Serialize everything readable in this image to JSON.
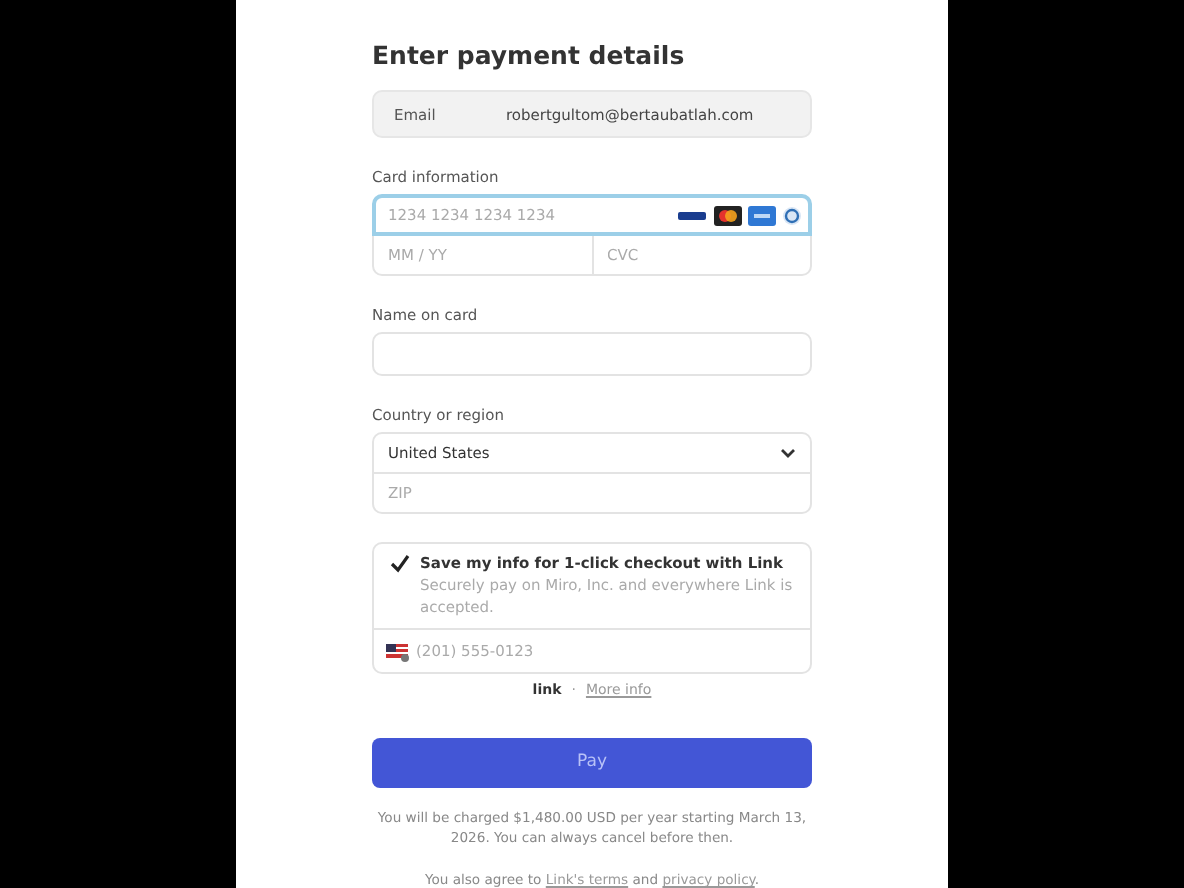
{
  "title": "Enter payment details",
  "email": {
    "label": "Email",
    "value": "robertgultom@bertaubatlah.com"
  },
  "card": {
    "label": "Card information",
    "number_placeholder": "1234 1234 1234 1234",
    "focused": true,
    "expiry_placeholder": "MM / YY",
    "cvc_placeholder": "CVC"
  },
  "name": {
    "label": "Name on card"
  },
  "country": {
    "label": "Country or region",
    "value": "United States",
    "zip_placeholder": "ZIP"
  },
  "link": {
    "checked": true,
    "title": "Save my info for 1-click checkout with Link",
    "description": "Securely pay on Miro, Inc. and everywhere Link is accepted.",
    "phone_placeholder": "(201) 555-0123",
    "logo": "link",
    "separator": "·",
    "more_info": "More info"
  },
  "pay_button": "Pay",
  "charge_note": "You will be charged $1,480.00 USD per year starting March 13, 2026. You can always cancel before then.",
  "terms": {
    "before": "You also agree to",
    "terms_link": "Link's terms",
    "middle": "and",
    "privacy_link": "privacy policy",
    "after": "."
  }
}
